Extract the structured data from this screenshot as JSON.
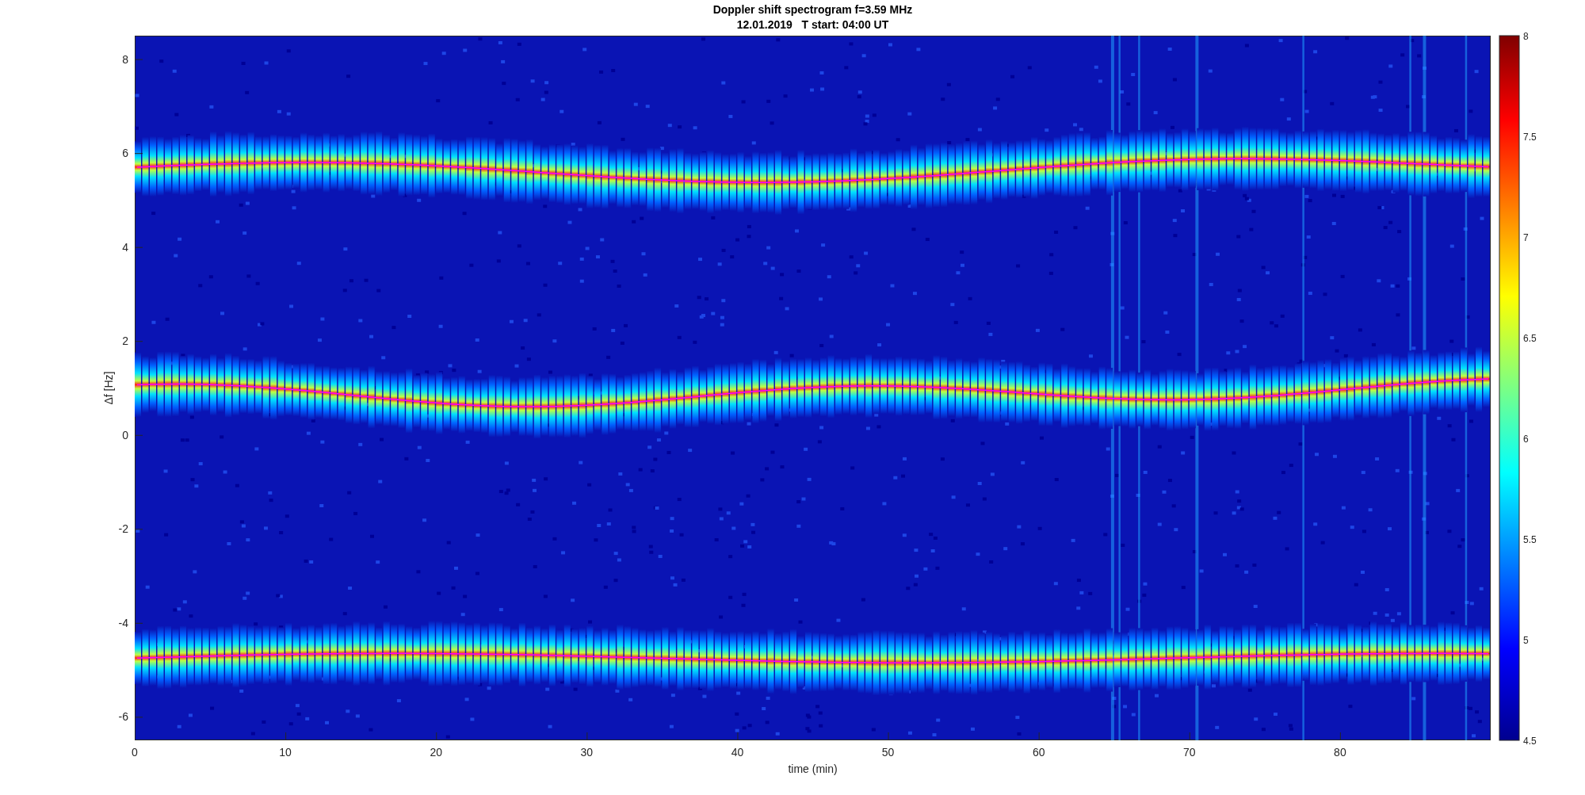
{
  "figure": {
    "title": "Doppler shift spectrogram f=3.59 MHz",
    "subtitle": "12.01.2019   T start: 04:00 UT",
    "xlabel": "time (min)",
    "ylabel": "Δf [Hz]",
    "xticks": [
      "0",
      "10",
      "20",
      "30",
      "40",
      "50",
      "60",
      "70",
      "80"
    ],
    "yticks": [
      "8",
      "6",
      "4",
      "2",
      "0",
      "-2",
      "-4",
      "-6"
    ],
    "colorbar_ticks": [
      "8",
      "7.5",
      "7",
      "6.5",
      "6",
      "5.5",
      "5",
      "4.5"
    ]
  }
}
